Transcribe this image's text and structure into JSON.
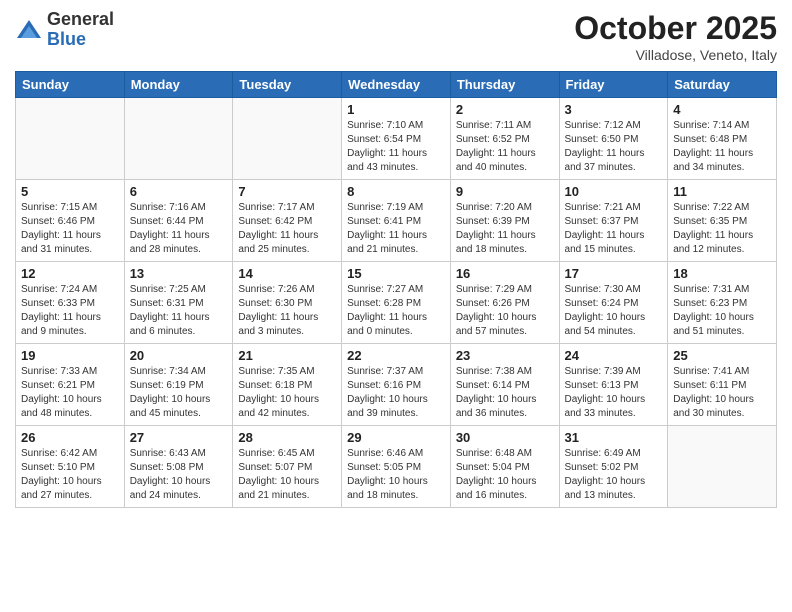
{
  "header": {
    "logo_general": "General",
    "logo_blue": "Blue",
    "month_title": "October 2025",
    "location": "Villadose, Veneto, Italy"
  },
  "weekdays": [
    "Sunday",
    "Monday",
    "Tuesday",
    "Wednesday",
    "Thursday",
    "Friday",
    "Saturday"
  ],
  "weeks": [
    [
      {
        "day": "",
        "info": ""
      },
      {
        "day": "",
        "info": ""
      },
      {
        "day": "",
        "info": ""
      },
      {
        "day": "1",
        "info": "Sunrise: 7:10 AM\nSunset: 6:54 PM\nDaylight: 11 hours\nand 43 minutes."
      },
      {
        "day": "2",
        "info": "Sunrise: 7:11 AM\nSunset: 6:52 PM\nDaylight: 11 hours\nand 40 minutes."
      },
      {
        "day": "3",
        "info": "Sunrise: 7:12 AM\nSunset: 6:50 PM\nDaylight: 11 hours\nand 37 minutes."
      },
      {
        "day": "4",
        "info": "Sunrise: 7:14 AM\nSunset: 6:48 PM\nDaylight: 11 hours\nand 34 minutes."
      }
    ],
    [
      {
        "day": "5",
        "info": "Sunrise: 7:15 AM\nSunset: 6:46 PM\nDaylight: 11 hours\nand 31 minutes."
      },
      {
        "day": "6",
        "info": "Sunrise: 7:16 AM\nSunset: 6:44 PM\nDaylight: 11 hours\nand 28 minutes."
      },
      {
        "day": "7",
        "info": "Sunrise: 7:17 AM\nSunset: 6:42 PM\nDaylight: 11 hours\nand 25 minutes."
      },
      {
        "day": "8",
        "info": "Sunrise: 7:19 AM\nSunset: 6:41 PM\nDaylight: 11 hours\nand 21 minutes."
      },
      {
        "day": "9",
        "info": "Sunrise: 7:20 AM\nSunset: 6:39 PM\nDaylight: 11 hours\nand 18 minutes."
      },
      {
        "day": "10",
        "info": "Sunrise: 7:21 AM\nSunset: 6:37 PM\nDaylight: 11 hours\nand 15 minutes."
      },
      {
        "day": "11",
        "info": "Sunrise: 7:22 AM\nSunset: 6:35 PM\nDaylight: 11 hours\nand 12 minutes."
      }
    ],
    [
      {
        "day": "12",
        "info": "Sunrise: 7:24 AM\nSunset: 6:33 PM\nDaylight: 11 hours\nand 9 minutes."
      },
      {
        "day": "13",
        "info": "Sunrise: 7:25 AM\nSunset: 6:31 PM\nDaylight: 11 hours\nand 6 minutes."
      },
      {
        "day": "14",
        "info": "Sunrise: 7:26 AM\nSunset: 6:30 PM\nDaylight: 11 hours\nand 3 minutes."
      },
      {
        "day": "15",
        "info": "Sunrise: 7:27 AM\nSunset: 6:28 PM\nDaylight: 11 hours\nand 0 minutes."
      },
      {
        "day": "16",
        "info": "Sunrise: 7:29 AM\nSunset: 6:26 PM\nDaylight: 10 hours\nand 57 minutes."
      },
      {
        "day": "17",
        "info": "Sunrise: 7:30 AM\nSunset: 6:24 PM\nDaylight: 10 hours\nand 54 minutes."
      },
      {
        "day": "18",
        "info": "Sunrise: 7:31 AM\nSunset: 6:23 PM\nDaylight: 10 hours\nand 51 minutes."
      }
    ],
    [
      {
        "day": "19",
        "info": "Sunrise: 7:33 AM\nSunset: 6:21 PM\nDaylight: 10 hours\nand 48 minutes."
      },
      {
        "day": "20",
        "info": "Sunrise: 7:34 AM\nSunset: 6:19 PM\nDaylight: 10 hours\nand 45 minutes."
      },
      {
        "day": "21",
        "info": "Sunrise: 7:35 AM\nSunset: 6:18 PM\nDaylight: 10 hours\nand 42 minutes."
      },
      {
        "day": "22",
        "info": "Sunrise: 7:37 AM\nSunset: 6:16 PM\nDaylight: 10 hours\nand 39 minutes."
      },
      {
        "day": "23",
        "info": "Sunrise: 7:38 AM\nSunset: 6:14 PM\nDaylight: 10 hours\nand 36 minutes."
      },
      {
        "day": "24",
        "info": "Sunrise: 7:39 AM\nSunset: 6:13 PM\nDaylight: 10 hours\nand 33 minutes."
      },
      {
        "day": "25",
        "info": "Sunrise: 7:41 AM\nSunset: 6:11 PM\nDaylight: 10 hours\nand 30 minutes."
      }
    ],
    [
      {
        "day": "26",
        "info": "Sunrise: 6:42 AM\nSunset: 5:10 PM\nDaylight: 10 hours\nand 27 minutes."
      },
      {
        "day": "27",
        "info": "Sunrise: 6:43 AM\nSunset: 5:08 PM\nDaylight: 10 hours\nand 24 minutes."
      },
      {
        "day": "28",
        "info": "Sunrise: 6:45 AM\nSunset: 5:07 PM\nDaylight: 10 hours\nand 21 minutes."
      },
      {
        "day": "29",
        "info": "Sunrise: 6:46 AM\nSunset: 5:05 PM\nDaylight: 10 hours\nand 18 minutes."
      },
      {
        "day": "30",
        "info": "Sunrise: 6:48 AM\nSunset: 5:04 PM\nDaylight: 10 hours\nand 16 minutes."
      },
      {
        "day": "31",
        "info": "Sunrise: 6:49 AM\nSunset: 5:02 PM\nDaylight: 10 hours\nand 13 minutes."
      },
      {
        "day": "",
        "info": ""
      }
    ]
  ]
}
